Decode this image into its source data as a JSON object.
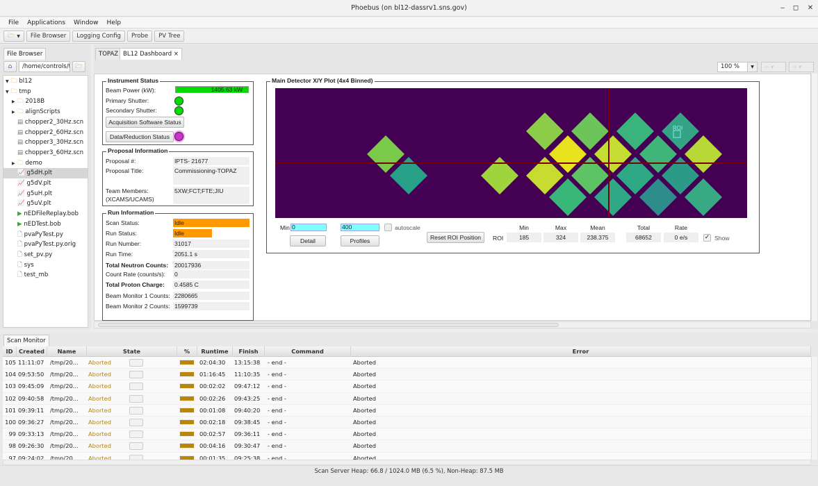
{
  "window": {
    "title": "Phoebus (on bl12-dassrv1.sns.gov)",
    "minimize": "‒",
    "maximize": "◻",
    "close": "✕"
  },
  "menu": [
    "File",
    "Applications",
    "Window",
    "Help"
  ],
  "toolbar": {
    "open_icon": "folder-open-icon",
    "buttons": [
      "File Browser",
      "Logging Config",
      "Probe",
      "PV Tree"
    ]
  },
  "file_browser": {
    "tab": "File Browser",
    "path": "/home/controls/t",
    "tree": [
      {
        "label": "bl12",
        "type": "folder",
        "expanded": true,
        "depth": 0
      },
      {
        "label": "tmp",
        "type": "folder",
        "expanded": true,
        "depth": 0
      },
      {
        "label": "2018B",
        "type": "folder",
        "expanded": false,
        "depth": 1
      },
      {
        "label": "alignScripts",
        "type": "folder",
        "expanded": false,
        "depth": 1
      },
      {
        "label": "chopper2_30Hz.scn",
        "type": "scan",
        "depth": 1
      },
      {
        "label": "chopper2_60Hz.scn",
        "type": "scan",
        "depth": 1
      },
      {
        "label": "chopper3_30Hz.scn",
        "type": "scan",
        "depth": 1
      },
      {
        "label": "chopper3_60Hz.scn",
        "type": "scan",
        "depth": 1
      },
      {
        "label": "demo",
        "type": "folder",
        "expanded": false,
        "depth": 1
      },
      {
        "label": "g5dH.plt",
        "type": "plot",
        "depth": 1,
        "selected": true
      },
      {
        "label": "g5dV.plt",
        "type": "plot",
        "depth": 1
      },
      {
        "label": "g5uH.plt",
        "type": "plot",
        "depth": 1
      },
      {
        "label": "g5uV.plt",
        "type": "plot",
        "depth": 1
      },
      {
        "label": "nEDFileReplay.bob",
        "type": "display",
        "depth": 1
      },
      {
        "label": "nEDTest.bob",
        "type": "display",
        "depth": 1
      },
      {
        "label": "pvaPyTest.py",
        "type": "file",
        "depth": 1
      },
      {
        "label": "pvaPyTest.py.orig",
        "type": "file",
        "depth": 1
      },
      {
        "label": "set_pv.py",
        "type": "file",
        "depth": 1
      },
      {
        "label": "sys",
        "type": "file",
        "depth": 1
      },
      {
        "label": "test_mb",
        "type": "file",
        "depth": 1
      }
    ]
  },
  "tabs": [
    {
      "label": "TOPAZ"
    },
    {
      "label": "BL12 Dashboard",
      "close": "×",
      "active": true
    }
  ],
  "zoom": "100 %",
  "instrument": {
    "title": "Instrument Status",
    "beam_power_label": "Beam Power (kW):",
    "beam_power_value": "1405.63 kW",
    "primary_label": "Primary Shutter:",
    "secondary_label": "Secondary Shutter:",
    "acq_button": "Acquisition Software Status",
    "data_button": "Data/Reduction Status",
    "colors": {
      "ok": "#00dd00",
      "status": "#cc33cc"
    }
  },
  "proposal": {
    "title": "Proposal Information",
    "num_label": "Proposal #:",
    "num_value": "IPTS- 21677",
    "title_label": "Proposal Title:",
    "title_value": "Commissioning-TOPAZ",
    "team_label1": "Team Members:",
    "team_label2": "(XCAMS/UCAMS)",
    "team_value": "5XW;FCT;FTE;JIU"
  },
  "run": {
    "title": "Run Information",
    "rows": [
      {
        "label": "Scan Status:",
        "value": "Idle",
        "bold": false
      },
      {
        "label": "Run Status:",
        "value": "Idle",
        "bold": false
      },
      {
        "label": "Run Number:",
        "value": "31017",
        "bold": false
      },
      {
        "label": "Run Time:",
        "value": "2051.1 s",
        "bold": false
      },
      {
        "label": "Total Neutron Counts:",
        "value": "20017936",
        "bold": true
      },
      {
        "label": "Count Rate (counts/s):",
        "value": "0",
        "bold": false
      },
      {
        "label": "Total Proton Charge:",
        "value": "0.4585 C",
        "bold": true
      },
      {
        "label": "Beam Monitor 1 Counts:",
        "value": "2280665",
        "bold": false
      },
      {
        "label": "Beam Monitor 2 Counts:",
        "value": "1599739",
        "bold": false
      }
    ],
    "idle_color": "#ff9900"
  },
  "detector": {
    "title": "Main Detector X/Y Plot (4x4 Binned)",
    "roi_label": "ROI",
    "min_label": "Min",
    "min_value": "0",
    "max_value": "400",
    "autoscale_label": "autoscale",
    "detail_button": "Detail",
    "profiles_button": "Profiles",
    "reset_roi_button": "Reset ROI Position",
    "roi_row_label": "ROI",
    "stats_headers": [
      "Min",
      "Max",
      "Mean",
      "Total",
      "Rate"
    ],
    "stats_values": [
      "185",
      "324",
      "238.375",
      "68652",
      "0 e/s"
    ],
    "show_label": "Show",
    "show_checked": true,
    "background_color": "#440154"
  },
  "scan_monitor": {
    "tab": "Scan Monitor",
    "columns": [
      "ID",
      "Created",
      "Name",
      "State",
      "%",
      "Runtime",
      "Finish",
      "Command",
      "Error"
    ],
    "rows": [
      {
        "id": "105",
        "created": "11:11:07",
        "name": "/tmp/20...",
        "state": "Aborted",
        "runtime": "02:04:30",
        "finish": "13:15:38",
        "command": "- end -",
        "error": "Aborted"
      },
      {
        "id": "104",
        "created": "09:53:50",
        "name": "/tmp/20...",
        "state": "Aborted",
        "runtime": "01:16:45",
        "finish": "11:10:35",
        "command": "- end -",
        "error": "Aborted"
      },
      {
        "id": "103",
        "created": "09:45:09",
        "name": "/tmp/20...",
        "state": "Aborted",
        "runtime": "00:02:02",
        "finish": "09:47:12",
        "command": "- end -",
        "error": "Aborted"
      },
      {
        "id": "102",
        "created": "09:40:58",
        "name": "/tmp/20...",
        "state": "Aborted",
        "runtime": "00:02:26",
        "finish": "09:43:25",
        "command": "- end -",
        "error": "Aborted"
      },
      {
        "id": "101",
        "created": "09:39:11",
        "name": "/tmp/20...",
        "state": "Aborted",
        "runtime": "00:01:08",
        "finish": "09:40:20",
        "command": "- end -",
        "error": "Aborted"
      },
      {
        "id": "100",
        "created": "09:36:27",
        "name": "/tmp/20...",
        "state": "Aborted",
        "runtime": "00:02:18",
        "finish": "09:38:45",
        "command": "- end -",
        "error": "Aborted"
      },
      {
        "id": "99",
        "created": "09:33:13",
        "name": "/tmp/20...",
        "state": "Aborted",
        "runtime": "00:02:57",
        "finish": "09:36:11",
        "command": "- end -",
        "error": "Aborted"
      },
      {
        "id": "98",
        "created": "09:26:30",
        "name": "/tmp/20...",
        "state": "Aborted",
        "runtime": "00:04:16",
        "finish": "09:30:47",
        "command": "- end -",
        "error": "Aborted"
      },
      {
        "id": "97",
        "created": "09:24:02",
        "name": "/tmp/20...",
        "state": "Aborted",
        "runtime": "00:01:35",
        "finish": "09:25:38",
        "command": "- end -",
        "error": "Aborted"
      }
    ],
    "aborted_color": "#b8860b",
    "status": "Scan Server Heap: 66.8 / 1024.0 MB (6.5 %), Non-Heap: 87.5 MB"
  }
}
